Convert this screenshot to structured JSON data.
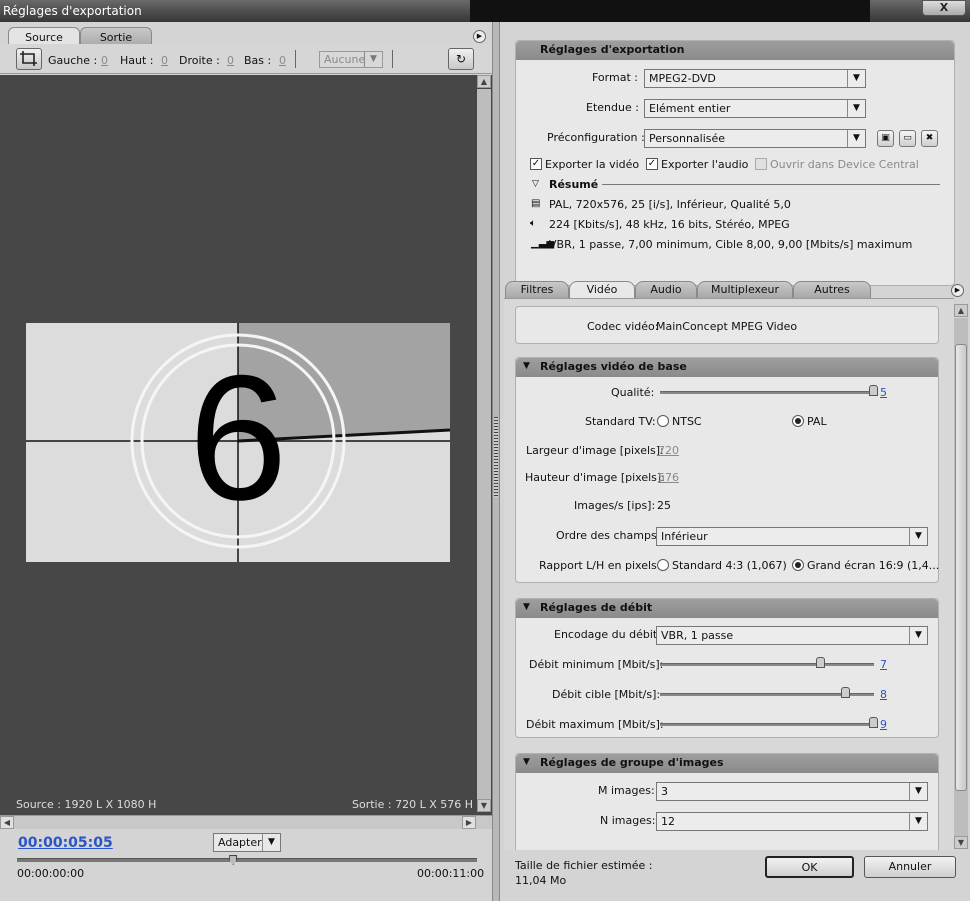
{
  "window": {
    "title": "Réglages d'exportation",
    "close": "X"
  },
  "left": {
    "tabs": [
      {
        "label": "Source"
      },
      {
        "label": "Sortie"
      }
    ],
    "crop": {
      "gauche_label": "Gauche :",
      "gauche_value": "0",
      "haut_label": "Haut :",
      "haut_value": "0",
      "droite_label": "Droite :",
      "droite_value": "0",
      "bas_label": "Bas :",
      "bas_value": "0",
      "ratio_value": "Aucune"
    },
    "preview": {
      "countdown_number": "6"
    },
    "source_info": "Source : 1920 L X 1080 H",
    "output_info": "Sortie : 720 L X 576 H",
    "timeline": {
      "current": "00:00:05:05",
      "zoom": "Adapter",
      "start": "00:00:00:00",
      "end": "00:00:11:00",
      "playhead_fraction": 0.47
    }
  },
  "export": {
    "header": "Réglages d'exportation",
    "format_label": "Format :",
    "format_value": "MPEG2-DVD",
    "etendue_label": "Etendue :",
    "etendue_value": "Elément entier",
    "preset_label": "Préconfiguration :",
    "preset_value": "Personnalisée",
    "export_video": "Exporter la vidéo",
    "export_audio": "Exporter l'audio",
    "device_central": "Ouvrir dans Device Central",
    "summary_title": "Résumé",
    "summary_video": "PAL, 720x576, 25 [i/s], Inférieur, Qualité 5,0",
    "summary_audio": "224 [Kbits/s], 48 kHz, 16 bits, Stéréo, MPEG",
    "summary_bitrate": "VBR, 1 passe, 7,00 minimum, Cible 8,00, 9,00 [Mbits/s] maximum"
  },
  "tabs": [
    {
      "label": "Filtres"
    },
    {
      "label": "Vidéo"
    },
    {
      "label": "Audio"
    },
    {
      "label": "Multiplexeur"
    },
    {
      "label": "Autres"
    }
  ],
  "codec": {
    "label": "Codec vidéo:",
    "value": "MainConcept MPEG Video"
  },
  "basic": {
    "header": "Réglages vidéo de base",
    "quality_label": "Qualité:",
    "quality_value": "5",
    "quality_fraction": 1.0,
    "tv_label": "Standard TV:",
    "ntsc": "NTSC",
    "pal": "PAL",
    "width_label": "Largeur d'image [pixels]:",
    "width_value": "720",
    "height_label": "Hauteur d'image [pixels]:",
    "height_value": "576",
    "fps_label": "Images/s [ips]:",
    "fps_value": "25",
    "field_label": "Ordre des champs:",
    "field_value": "Inférieur",
    "aspect_label": "Rapport L/H en pixels:",
    "aspect_standard": "Standard 4:3 (1,067)",
    "aspect_wide": "Grand écran 16:9 (1,4..."
  },
  "bitrate": {
    "header": "Réglages de débit",
    "encoding_label": "Encodage du débit:",
    "encoding_value": "VBR, 1 passe",
    "min_label": "Débit minimum [Mbit/s]:",
    "min_value": "7",
    "min_fraction": 0.75,
    "target_label": "Débit cible [Mbit/s]:",
    "target_value": "8",
    "target_fraction": 0.87,
    "max_label": "Débit maximum [Mbit/s]:",
    "max_value": "9",
    "max_fraction": 1.0
  },
  "gop": {
    "header": "Réglages de groupe d'images",
    "m_label": "M images:",
    "m_value": "3",
    "n_label": "N images:",
    "n_value": "12"
  },
  "footer": {
    "size_label": "Taille de fichier estimée :",
    "size_value": "11,04 Mo",
    "ok": "OK",
    "cancel": "Annuler"
  }
}
